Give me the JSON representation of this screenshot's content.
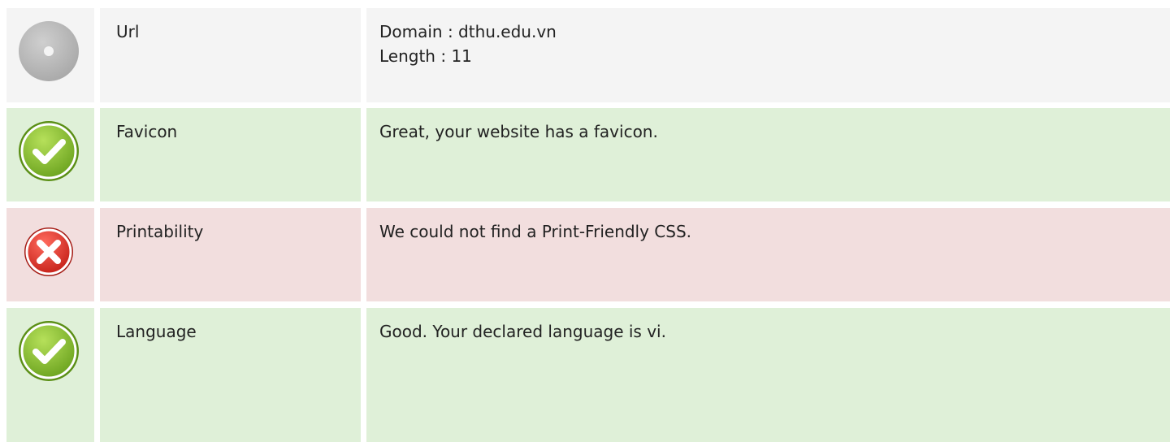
{
  "rows": [
    {
      "status": "neutral",
      "icon": "neutral-disc-icon",
      "label": "Url",
      "value_lines": [
        "Domain : dthu.edu.vn",
        "Length : 11"
      ]
    },
    {
      "status": "pass",
      "icon": "check-icon",
      "label": "Favicon",
      "value_lines": [
        "Great, your website has a favicon."
      ]
    },
    {
      "status": "fail",
      "icon": "cross-icon",
      "label": "Printability",
      "value_lines": [
        "We could not find a Print-Friendly CSS."
      ]
    },
    {
      "status": "pass",
      "icon": "check-icon",
      "label": "Language",
      "value_lines": [
        "Good. Your declared language is vi."
      ]
    }
  ],
  "colors": {
    "neutral_bg": "#f4f4f4",
    "pass_bg": "#dff0d8",
    "fail_bg": "#f2dede",
    "pass_icon": "#8cc63f",
    "fail_icon": "#e0312c",
    "neutral_icon": "#b3b3b3"
  }
}
